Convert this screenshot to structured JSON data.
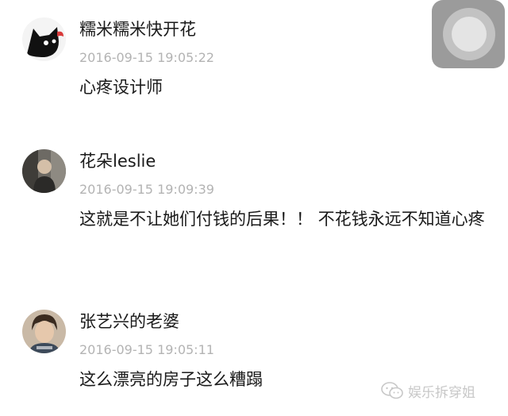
{
  "comments": [
    {
      "username": "糯米糯米快开花",
      "timestamp": "2016-09-15 19:05:22",
      "content": "心疼设计师",
      "avatar_icon": "black-cat-avatar"
    },
    {
      "username": "花朵leslie",
      "timestamp": "2016-09-15 19:09:39",
      "content": "这就是不让她们付钱的后果！！ 不花钱永远不知道心疼",
      "avatar_icon": "photo-avatar"
    },
    {
      "username": "张艺兴的老婆",
      "timestamp": "2016-09-15 19:05:11",
      "content": "这么漂亮的房子这么糟蹋",
      "avatar_icon": "portrait-avatar"
    }
  ],
  "watermark": {
    "text": "娱乐拆穿姐",
    "icon": "wechat-icon"
  },
  "floating_button": {
    "icon": "assistive-touch-icon"
  }
}
